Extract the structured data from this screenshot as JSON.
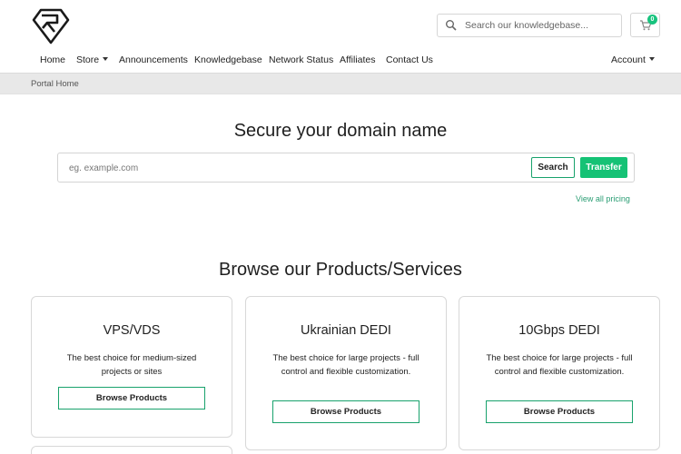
{
  "header": {
    "search_placeholder": "Search our knowledgebase...",
    "cart_count": "0"
  },
  "nav": {
    "home": "Home",
    "store": "Store",
    "announcements": "Announcements",
    "knowledgebase": "Knowledgebase",
    "network_status": "Network Status",
    "affiliates": "Affiliates",
    "contact_us": "Contact Us",
    "account": "Account"
  },
  "breadcrumb": {
    "current": "Portal Home"
  },
  "domain": {
    "title": "Secure your domain name",
    "placeholder": "eg. example.com",
    "search_label": "Search",
    "transfer_label": "Transfer",
    "view_pricing": "View all pricing"
  },
  "products": {
    "title": "Browse our Products/Services",
    "cards": [
      {
        "name": "VPS/VDS",
        "description": "The best choice for medium-sized projects or sites",
        "button": "Browse Products"
      },
      {
        "name": "Ukrainian DEDI",
        "description": "The best choice for large projects - full control and flexible customization.",
        "button": "Browse Products"
      },
      {
        "name": "10Gbps DEDI",
        "description": "The best choice for large projects - full control and flexible customization.",
        "button": "Browse Products"
      }
    ]
  },
  "colors": {
    "accent": "#15c275",
    "accent_border": "#18a26c",
    "breadcrumb_bg": "#e8e8e8"
  }
}
